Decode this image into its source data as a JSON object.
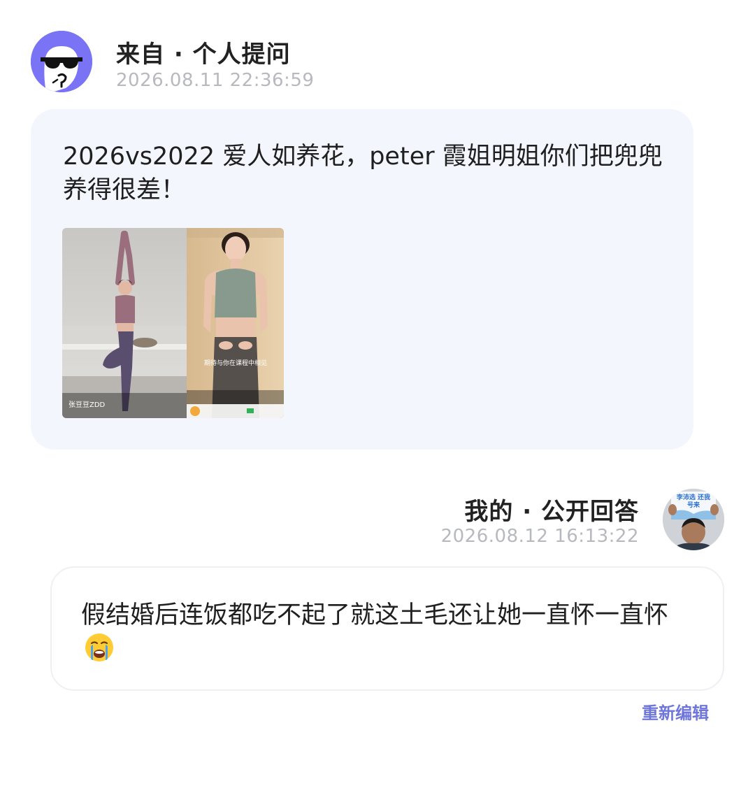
{
  "question": {
    "source_label": "来自 · 个人提问",
    "timestamp": "2026.08.11 22:36:59",
    "text": "2026vs2022 爱人如养花，peter 霞姐明姐你们把兜兜养得很差！",
    "images": [
      {
        "caption": "张豆豆ZDD"
      },
      {
        "caption": "期待与你在课程中相见"
      }
    ]
  },
  "answer": {
    "label": "我的 · 公开回答",
    "timestamp": "2026.08.12 16:13:22",
    "text": "假结婚后连饭都吃不起了就这土毛还让她一直怀一直怀",
    "avatar_sign_text": "李沛选 还我号来",
    "edit_label": "重新编辑"
  },
  "colors": {
    "question_avatar_bg": "#7b73f5",
    "question_card_bg": "#f3f6fd",
    "timestamp": "#b7b9bf",
    "edit_link": "#6f76d9"
  },
  "icons": {
    "question_avatar": "sunglasses-face-icon",
    "answer_emoji": "crying-face-emoji"
  }
}
